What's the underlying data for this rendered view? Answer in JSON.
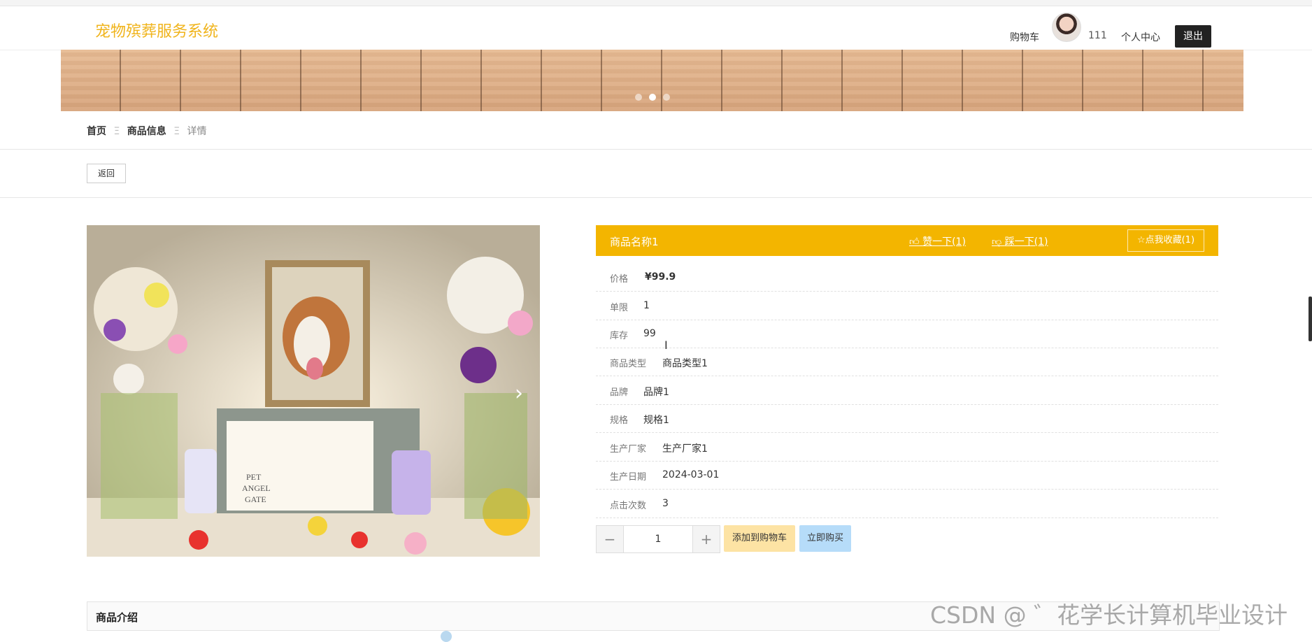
{
  "header": {
    "brand": "宠物殡葬服务系统",
    "cart_label": "购物车",
    "username": "111",
    "center_label": "个人中心",
    "logout_label": "退出"
  },
  "breadcrumb": {
    "home": "首页",
    "sep": "Ξ",
    "goods": "商品信息",
    "detail": "详情"
  },
  "back_label": "返回",
  "product": {
    "name": "商品名称1",
    "like_label": "赞一下(1)",
    "dislike_label": "踩一下(1)",
    "favorite_label": "点我收藏(1)",
    "image_text": "PET\nANGEL\nGATE",
    "fields": {
      "price": {
        "label": "价格",
        "value": "¥99.9"
      },
      "limit": {
        "label": "单限",
        "value": "1"
      },
      "stock": {
        "label": "库存",
        "value": "99"
      },
      "type": {
        "label": "商品类型",
        "value": "商品类型1"
      },
      "brand": {
        "label": "品牌",
        "value": "品牌1"
      },
      "spec": {
        "label": "规格",
        "value": "规格1"
      },
      "maker": {
        "label": "生产厂家",
        "value": "生产厂家1"
      },
      "date": {
        "label": "生产日期",
        "value": "2024-03-01"
      },
      "clicks": {
        "label": "点击次数",
        "value": "3"
      }
    }
  },
  "purchase": {
    "minus": "−",
    "quantity": "1",
    "plus": "+",
    "add_to_cart": "添加到购物车",
    "buy_now": "立即购买"
  },
  "intro_title": "商品介绍",
  "watermark": "CSDN @ ゛花学长计算机毕业设计",
  "colors": {
    "brand": "#f0b41c",
    "title_bar": "#f3b500",
    "add_cart": "#fde3a4",
    "buy_now": "#b6dcf9",
    "logout": "#222222"
  }
}
